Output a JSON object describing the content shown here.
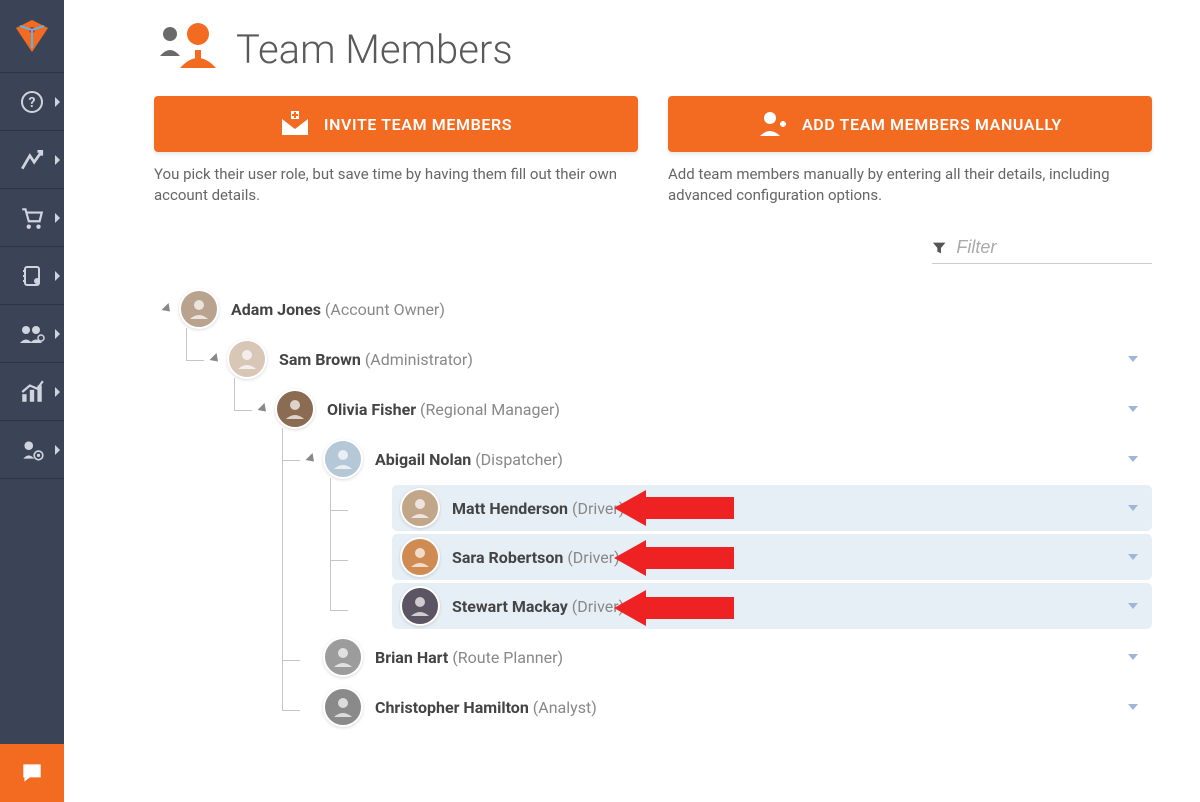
{
  "page": {
    "title": "Team Members",
    "invite_btn": "INVITE TEAM MEMBERS",
    "invite_desc": "You pick their user role, but save time by having them fill out their own account details.",
    "add_btn": "ADD TEAM MEMBERS MANUALLY",
    "add_desc": "Add team members manually by entering all their details, including advanced configuration options.",
    "filter_placeholder": "Filter"
  },
  "tree": [
    {
      "indent": 0,
      "name": "Adam Jones",
      "role": "Account Owner",
      "has_caret": true,
      "menu": false,
      "hl": false,
      "avatar": "#b9a38f"
    },
    {
      "indent": 1,
      "name": "Sam Brown",
      "role": "Administrator",
      "has_caret": true,
      "menu": true,
      "hl": false,
      "avatar": "#d8c7b6"
    },
    {
      "indent": 2,
      "name": "Olivia Fisher",
      "role": "Regional Manager",
      "has_caret": true,
      "menu": true,
      "hl": false,
      "avatar": "#8b6b52"
    },
    {
      "indent": 3,
      "name": "Abigail Nolan",
      "role": "Dispatcher",
      "has_caret": true,
      "menu": true,
      "hl": false,
      "avatar": "#b5c8d8"
    },
    {
      "indent": 4,
      "name": "Matt Henderson",
      "role": "Driver",
      "has_caret": false,
      "menu": true,
      "hl": true,
      "avatar": "#c2a68a",
      "arrow": true
    },
    {
      "indent": 4,
      "name": "Sara Robertson",
      "role": "Driver",
      "has_caret": false,
      "menu": true,
      "hl": true,
      "avatar": "#d08b52",
      "arrow": true
    },
    {
      "indent": 4,
      "name": "Stewart Mackay",
      "role": "Driver",
      "has_caret": false,
      "menu": true,
      "hl": true,
      "avatar": "#5b5462",
      "arrow": true
    },
    {
      "indent": 3,
      "name": "Brian Hart",
      "role": "Route Planner",
      "has_caret": false,
      "menu": true,
      "hl": false,
      "avatar": "#9c9c9c"
    },
    {
      "indent": 3,
      "name": "Christopher Hamilton",
      "role": "Analyst",
      "has_caret": false,
      "menu": true,
      "hl": false,
      "avatar": "#8a8a8a"
    }
  ],
  "sidebar_icons": [
    "help-icon",
    "route-icon",
    "orders-icon",
    "address-book-icon",
    "team-icon",
    "analytics-icon",
    "settings-icon"
  ]
}
